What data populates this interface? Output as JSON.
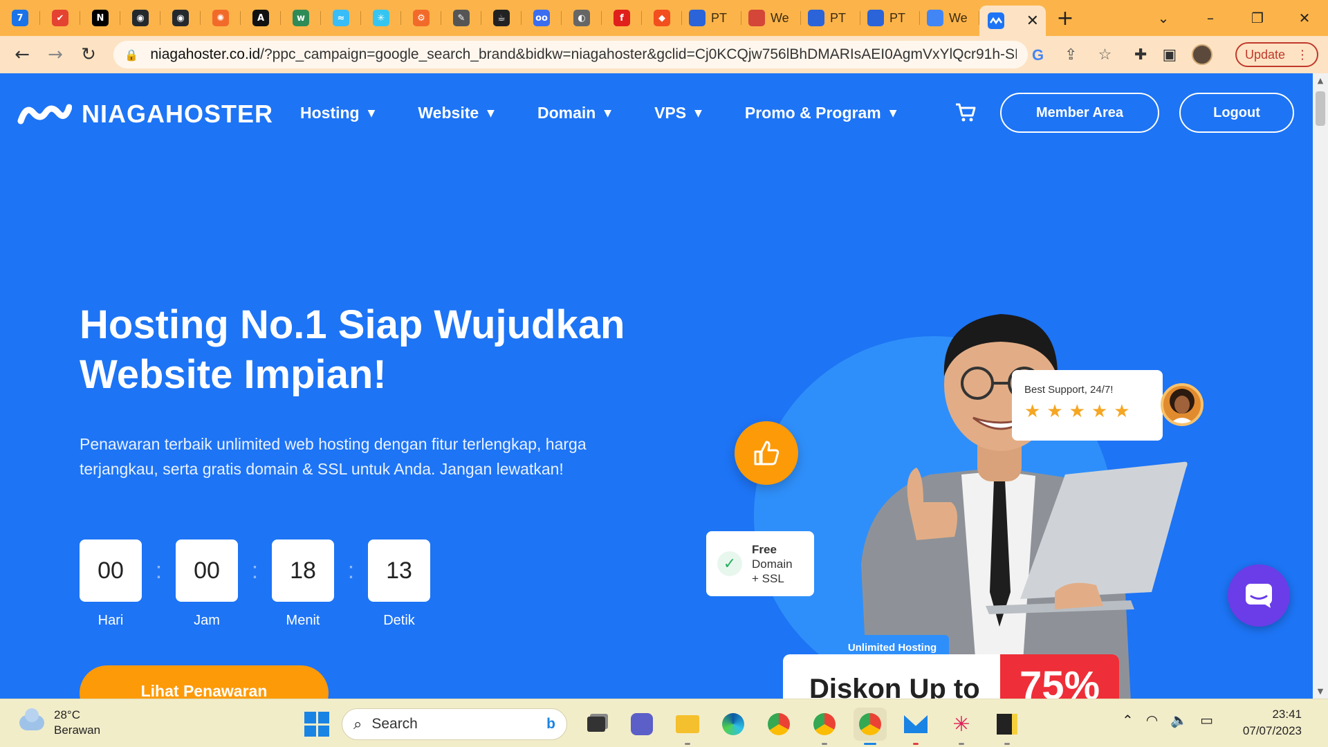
{
  "browser": {
    "tabs": [
      {
        "icon": "calendar-icon",
        "color": "#1a73e8",
        "glyph": "7"
      },
      {
        "icon": "todoist-icon",
        "color": "#e44332",
        "glyph": "✔"
      },
      {
        "icon": "notion-icon",
        "color": "#000000",
        "glyph": "N"
      },
      {
        "icon": "github-icon",
        "color": "#24292e",
        "glyph": "◉"
      },
      {
        "icon": "github-icon",
        "color": "#24292e",
        "glyph": "◉"
      },
      {
        "icon": "sun-icon",
        "color": "#f26a2a",
        "glyph": "✺"
      },
      {
        "icon": "dev-icon",
        "color": "#111111",
        "glyph": "A"
      },
      {
        "icon": "w-icon",
        "color": "#2e8b57",
        "glyph": "w"
      },
      {
        "icon": "tailwind-icon",
        "color": "#38bdf8",
        "glyph": "≈"
      },
      {
        "icon": "slack-icon",
        "color": "#36c5f0",
        "glyph": "✳"
      },
      {
        "icon": "openai-icon",
        "color": "#f26a2a",
        "glyph": "⚙"
      },
      {
        "icon": "feather-icon",
        "color": "#555555",
        "glyph": "✎"
      },
      {
        "icon": "cup-icon",
        "color": "#222222",
        "glyph": "☕"
      },
      {
        "icon": "oo-icon",
        "color": "#3a6df0",
        "glyph": "oo"
      },
      {
        "icon": "globe-icon",
        "color": "#666666",
        "glyph": "◐"
      },
      {
        "icon": "fcc-icon",
        "color": "#e0201b",
        "glyph": "f"
      },
      {
        "icon": "figma-icon",
        "color": "#f24e1e",
        "glyph": "◆"
      }
    ],
    "labeled_tabs": [
      {
        "icon": "wordpress-icon",
        "label": "PT"
      },
      {
        "icon": "gmail-icon",
        "label": "We"
      },
      {
        "icon": "wordpress-icon",
        "label": "PT"
      },
      {
        "icon": "wordpress-icon",
        "label": "PT"
      },
      {
        "icon": "docs-icon",
        "label": "We"
      }
    ],
    "active_tab_close": "✕",
    "new_tab": "+",
    "url_host": "niagahoster.co.id",
    "url_rest": "/?ppc_campaign=google_search_brand&bidkw=niagahoster&gclid=Cj0KCQjw756lBhDMARIsAEI0AgmVxYlQcr91h-SH...",
    "update_label": "Update"
  },
  "site": {
    "logo_text": "NIAGAHOSTER",
    "nav": [
      {
        "label": "Hosting"
      },
      {
        "label": "Website"
      },
      {
        "label": "Domain"
      },
      {
        "label": "VPS"
      },
      {
        "label": "Promo & Program"
      }
    ],
    "member_area_label": "Member Area",
    "logout_label": "Logout",
    "hero_title": "Hosting No.1 Siap Wujudkan Website Impian!",
    "hero_desc": "Penawaran terbaik unlimited web hosting dengan fitur terlengkap, harga terjangkau, serta gratis domain & SSL untuk Anda. Jangan lewatkan!",
    "countdown": [
      {
        "value": "00",
        "label": "Hari"
      },
      {
        "value": "00",
        "label": "Jam"
      },
      {
        "value": "18",
        "label": "Menit"
      },
      {
        "value": "13",
        "label": "Detik"
      }
    ],
    "cta_label": "Lihat Penawaran",
    "support_card_title": "Best Support, 24/7!",
    "support_stars": 5,
    "domain_card": {
      "line1": "Free",
      "line2": "Domain",
      "line3": "+ SSL"
    },
    "unlimited_pill": "Unlimited Hosting",
    "diskon_text": "Diskon Up to",
    "diskon_percent": "75%"
  },
  "taskbar": {
    "temperature": "28°C",
    "weather": "Berawan",
    "search_placeholder": "Search",
    "time": "23:41",
    "date": "07/07/2023"
  }
}
